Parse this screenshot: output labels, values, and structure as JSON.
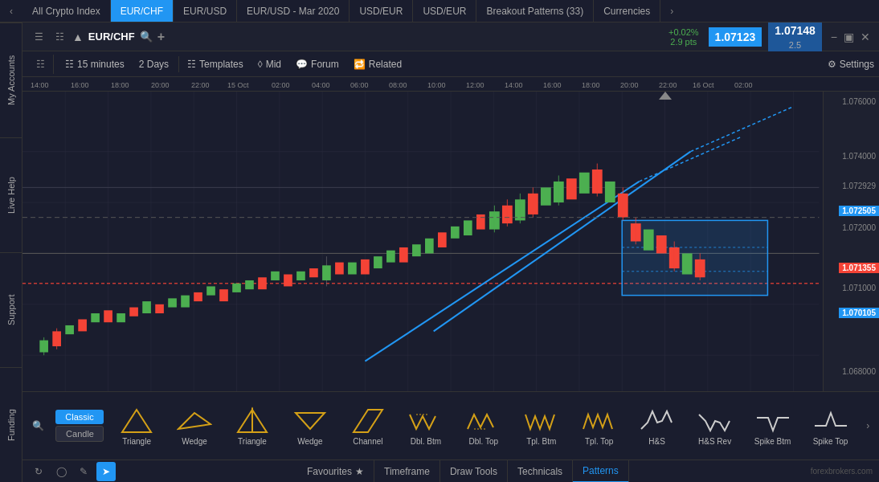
{
  "tabs": [
    {
      "label": "All Crypto Index",
      "active": false
    },
    {
      "label": "EUR/CHF",
      "active": true
    },
    {
      "label": "EUR/USD",
      "active": false
    },
    {
      "label": "EUR/USD - Mar 2020",
      "active": false
    },
    {
      "label": "USD/EUR",
      "active": false
    },
    {
      "label": "USD/EUR",
      "active": false
    },
    {
      "label": "Breakout Patterns (33)",
      "active": false
    },
    {
      "label": "Currencies",
      "active": false
    }
  ],
  "symbol": "EUR/CHF",
  "price_change": "+0.02%",
  "price_pts": "2.9 pts",
  "price_bid": "1.07123",
  "price_ask": "1.07148",
  "price_spread": "2.5",
  "sidebar": {
    "items": [
      "My Accounts",
      "Live Help",
      "Support",
      "Funding"
    ]
  },
  "toolbar": {
    "timeframe_icon": "⊞",
    "timeframe": "15 minutes",
    "range": "2 Days",
    "templates_icon": "⊟",
    "templates": "Templates",
    "mid": "Mid",
    "forum": "Forum",
    "related": "Related",
    "settings": "Settings"
  },
  "price_levels": {
    "top": "1.076000",
    "l1": "1.074000",
    "l2": "1.072929",
    "l3": "1.072505",
    "l4": "1.072000",
    "l5": "1.071355",
    "l6": "1.071000",
    "l7": "1.070105",
    "bot": "1.068000"
  },
  "time_labels": [
    "14:00",
    "16:00",
    "18:00",
    "20:00",
    "22:00",
    "15 Oct",
    "02:00",
    "04:00",
    "06:00",
    "08:00",
    "10:00",
    "12:00",
    "14:00",
    "16:00",
    "18:00",
    "20:00",
    "22:00",
    "16 Oct",
    "02:00"
  ],
  "bottom_tools": [
    {
      "label": "Triangle",
      "icon": "△"
    },
    {
      "label": "Wedge",
      "icon": "◁"
    },
    {
      "label": "Triangle",
      "icon": "▷"
    },
    {
      "label": "Wedge",
      "icon": "◁"
    },
    {
      "label": "Channel",
      "icon": "⬡"
    },
    {
      "label": "Dbl. Btm",
      "icon": "⌇"
    },
    {
      "label": "Dbl. Top",
      "icon": "⌇"
    },
    {
      "label": "Tpl. Btm",
      "icon": "⌇"
    },
    {
      "label": "Tpl. Top",
      "icon": "⌇"
    },
    {
      "label": "H&S",
      "icon": "∧"
    },
    {
      "label": "H&S Rev",
      "icon": "∨"
    },
    {
      "label": "Spike Btm",
      "icon": "↓"
    },
    {
      "label": "Spike Top",
      "icon": "↑"
    }
  ],
  "bottom_nav": {
    "tabs": [
      "Favourites",
      "Timeframe",
      "Draw Tools",
      "Technicals",
      "Patterns"
    ],
    "active": "Patterns"
  },
  "classic_label": "Classic",
  "candle_label": "Candle"
}
